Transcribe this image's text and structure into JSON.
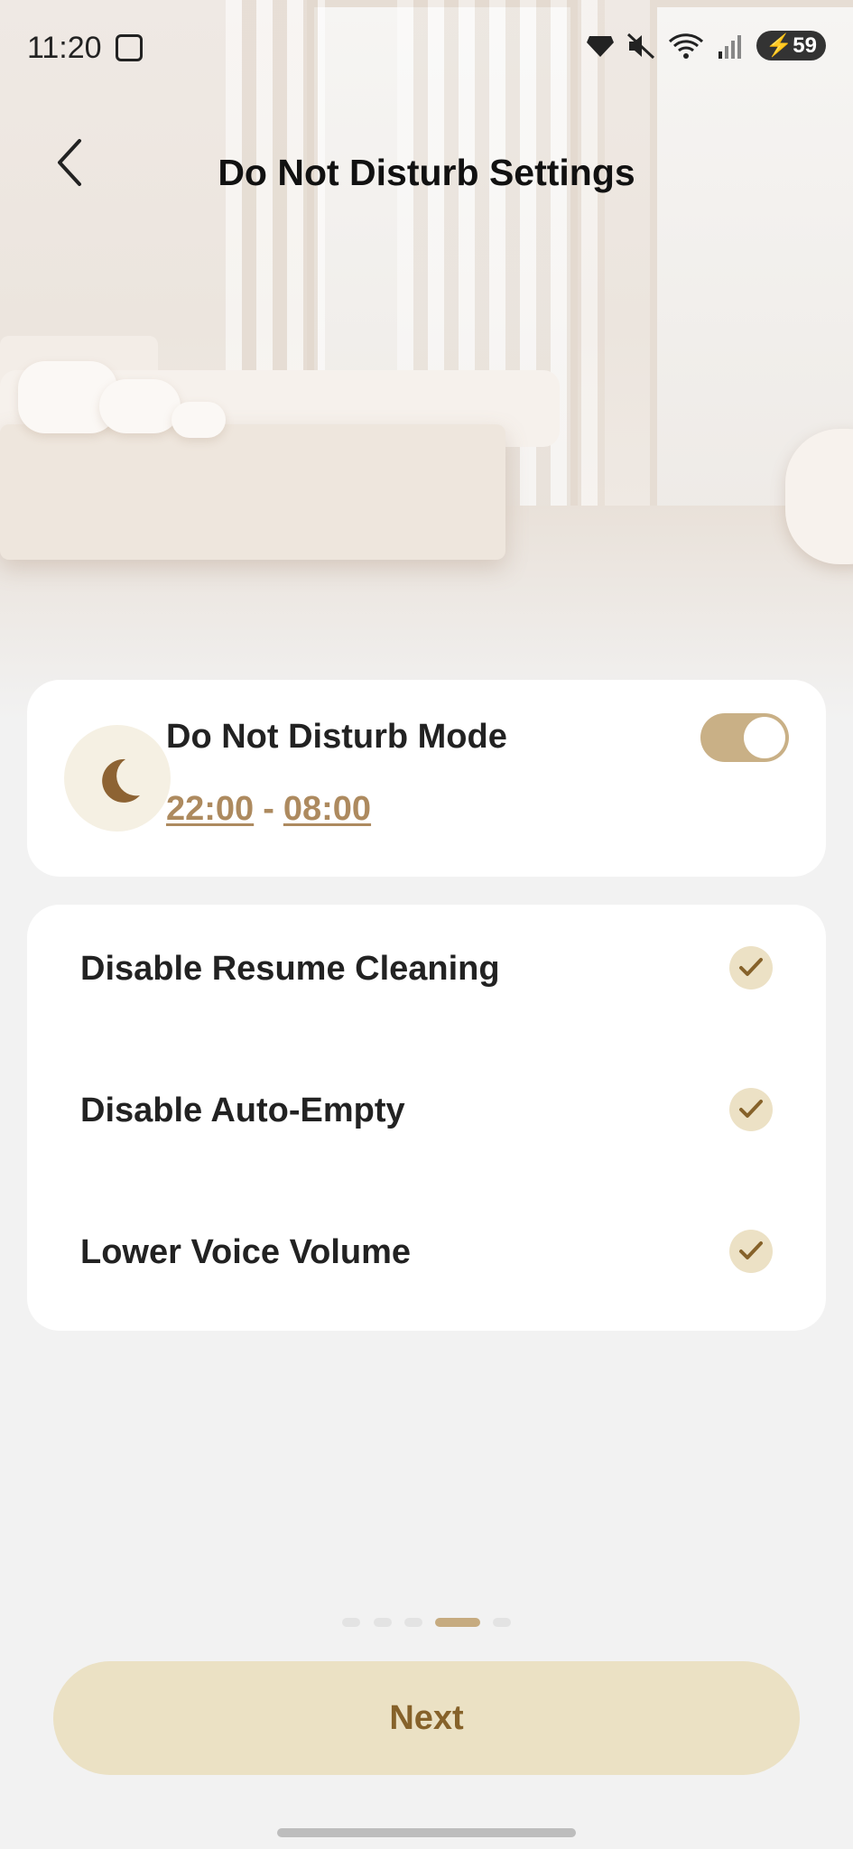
{
  "status_bar": {
    "time": "11:20",
    "battery": "59"
  },
  "header": {
    "title": "Do Not Disturb Settings"
  },
  "mode_card": {
    "label": "Do Not Disturb Mode",
    "start_time": "22:00",
    "separator": "-",
    "end_time": "08:00",
    "toggle_on": true
  },
  "options": [
    {
      "label": "Disable Resume Cleaning",
      "checked": true
    },
    {
      "label": "Disable Auto-Empty",
      "checked": true
    },
    {
      "label": "Lower Voice Volume",
      "checked": true
    }
  ],
  "pager": {
    "total": 5,
    "current": 4
  },
  "footer": {
    "next_label": "Next"
  },
  "colors": {
    "accent": "#c6ab80",
    "button_bg": "#ebe1c4",
    "button_text": "#86622a",
    "moon": "#8d6333"
  }
}
